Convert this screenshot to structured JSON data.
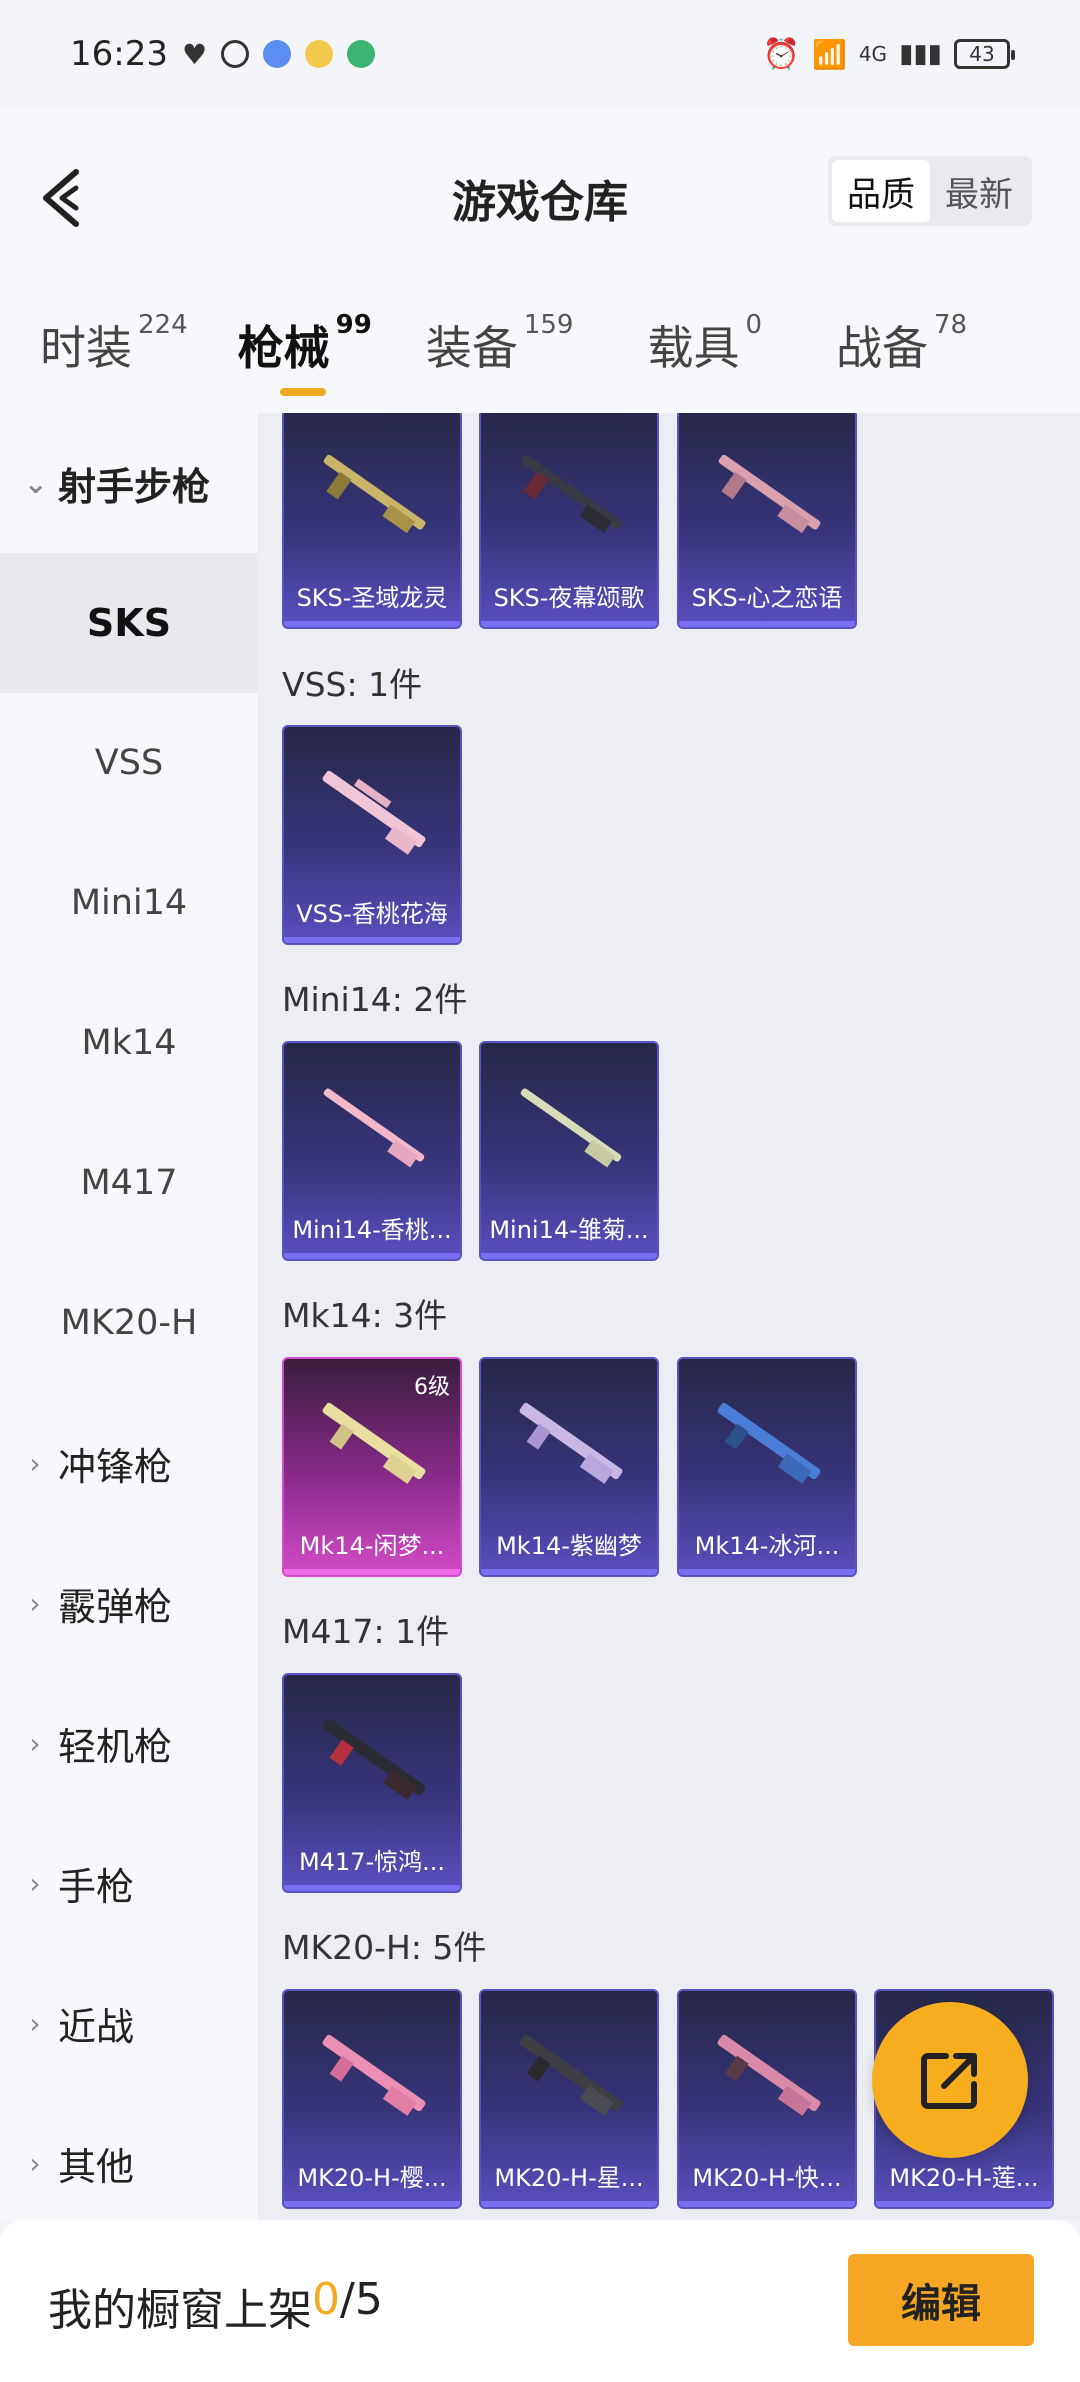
{
  "status_bar": {
    "time": "16:23",
    "network": "4G",
    "battery": "43"
  },
  "header": {
    "title": "游戏仓库",
    "sort_options": [
      "品质",
      "最新"
    ]
  },
  "tabs": [
    {
      "label": "时装",
      "count": "224"
    },
    {
      "label": "枪械",
      "count": "99"
    },
    {
      "label": "装备",
      "count": "159"
    },
    {
      "label": "载具",
      "count": "0"
    },
    {
      "label": "战备",
      "count": "78"
    }
  ],
  "sidebar": {
    "open_group": "射手步枪",
    "subitems": [
      "SKS",
      "VSS",
      "Mini14",
      "Mk14",
      "M417",
      "MK20-H"
    ],
    "groups": [
      "冲锋枪",
      "霰弹枪",
      "轻机枪",
      "手枪",
      "近战",
      "其他"
    ]
  },
  "sections": {
    "sks_cards": [
      "SKS-圣域龙灵",
      "SKS-夜幕颂歌",
      "SKS-心之恋语"
    ],
    "vss": {
      "label": "VSS: 1件",
      "cards": [
        "VSS-香桃花海"
      ]
    },
    "mini14": {
      "label": "Mini14: 2件",
      "cards": [
        "Mini14-香桃...",
        "Mini14-雏菊..."
      ]
    },
    "mk14": {
      "label": "Mk14: 3件",
      "cards": [
        "Mk14-闲梦...",
        "Mk14-紫幽梦",
        "Mk14-冰河..."
      ],
      "level": "6级"
    },
    "m417": {
      "label": "M417: 1件",
      "cards": [
        "M417-惊鸿..."
      ]
    },
    "mk20h": {
      "label": "MK20-H: 5件",
      "cards": [
        "MK20-H-樱...",
        "MK20-H-星...",
        "MK20-H-快...",
        "MK20-H-莲..."
      ]
    }
  },
  "bottom": {
    "showcase_label": "我的橱窗上架 ",
    "used": "0",
    "separator": "/",
    "total": "5",
    "edit_label": "编辑"
  },
  "colors": {
    "accent": "#f3a922",
    "card_purple": "#5a4fbf",
    "card_pink": "#d24bc8"
  }
}
